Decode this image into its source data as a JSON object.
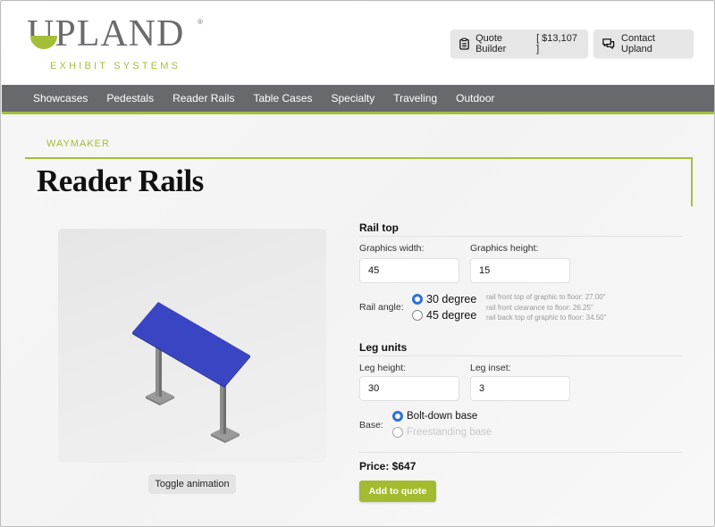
{
  "brand": {
    "name": "UPLAND",
    "registered_mark": "®",
    "tagline": "EXHIBIT SYSTEMS",
    "accent_color": "#a3bf3a",
    "logo_gray": "#6b6b6d"
  },
  "header": {
    "quote_builder": {
      "icon": "clipboard-icon",
      "label": "Quote Builder",
      "total": "[ $13,107 ]"
    },
    "contact": {
      "icon": "chat-bubbles-icon",
      "label": "Contact Upland"
    }
  },
  "nav": {
    "items": [
      {
        "label": "Showcases"
      },
      {
        "label": "Pedestals"
      },
      {
        "label": "Reader Rails"
      },
      {
        "label": "Table Cases"
      },
      {
        "label": "Specialty"
      },
      {
        "label": "Traveling"
      },
      {
        "label": "Outdoor"
      }
    ],
    "bg_color": "#68696d"
  },
  "page": {
    "eyebrow": "WAYMAKER",
    "title": "Reader Rails"
  },
  "viewer": {
    "toggle_label": "Toggle animation",
    "model_color": "#3a45c4"
  },
  "config": {
    "rail_top": {
      "title": "Rail top",
      "graphics_width_label": "Graphics width:",
      "graphics_width_value": "45",
      "graphics_height_label": "Graphics height:",
      "graphics_height_value": "15"
    },
    "rail_angle": {
      "label": "Rail angle:",
      "options": [
        {
          "label": "30 degree",
          "selected": true
        },
        {
          "label": "45 degree",
          "selected": false
        }
      ],
      "notes": [
        "rail front top of graphic to floor: 27.00\"",
        "rail front clearance to floor: 26.25\"",
        "rail back top of graphic to floor: 34.50\""
      ]
    },
    "leg_units": {
      "title": "Leg units",
      "leg_height_label": "Leg height:",
      "leg_height_value": "30",
      "leg_inset_label": "Leg inset:",
      "leg_inset_value": "3"
    },
    "base": {
      "label": "Base:",
      "options": [
        {
          "label": "Bolt-down base",
          "selected": true,
          "disabled": false
        },
        {
          "label": "Freestanding base",
          "selected": false,
          "disabled": true
        }
      ]
    },
    "price": "Price: $647",
    "add_button": "Add to quote"
  }
}
